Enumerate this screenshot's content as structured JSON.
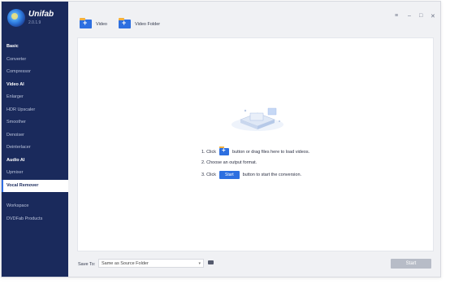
{
  "app": {
    "name": "Unifab",
    "version": "2.0.1.9"
  },
  "sidebar": {
    "items": [
      {
        "label": "Basic",
        "type": "header"
      },
      {
        "label": "Converter",
        "type": "item"
      },
      {
        "label": "Compressor",
        "type": "item"
      },
      {
        "label": "Video AI",
        "type": "header"
      },
      {
        "label": "Enlarger",
        "type": "item"
      },
      {
        "label": "HDR Upscaler",
        "type": "item"
      },
      {
        "label": "Smoother",
        "type": "item"
      },
      {
        "label": "Denoiser",
        "type": "item"
      },
      {
        "label": "Deinterlacer",
        "type": "item"
      },
      {
        "label": "Audio AI",
        "type": "header"
      },
      {
        "label": "Upmixer",
        "type": "item"
      },
      {
        "label": "Vocal Remover",
        "type": "active"
      }
    ],
    "bottom_items": [
      {
        "label": "Workspace"
      },
      {
        "label": "DVDFab Products"
      }
    ]
  },
  "toolbar": {
    "video_label": "Video",
    "video_folder_label": "Video Folder"
  },
  "window_controls": {
    "menu": "≡",
    "minimize": "–",
    "maximize": "□",
    "close": "✕"
  },
  "instructions": {
    "step1_prefix": "1. Click",
    "step1_suffix": "button or drag files here to load videos.",
    "step2": "2. Choose an output format.",
    "step3_prefix": "3. Click",
    "step3_button": "Start",
    "step3_suffix": "button to start the conversion."
  },
  "bottom": {
    "save_to_label": "Save To:",
    "save_to_value": "Same as Source Folder",
    "start_label": "Start"
  },
  "colors": {
    "sidebar_bg": "#1a2a5c",
    "accent": "#2d6fe0",
    "start_disabled": "#b7bcc7"
  }
}
